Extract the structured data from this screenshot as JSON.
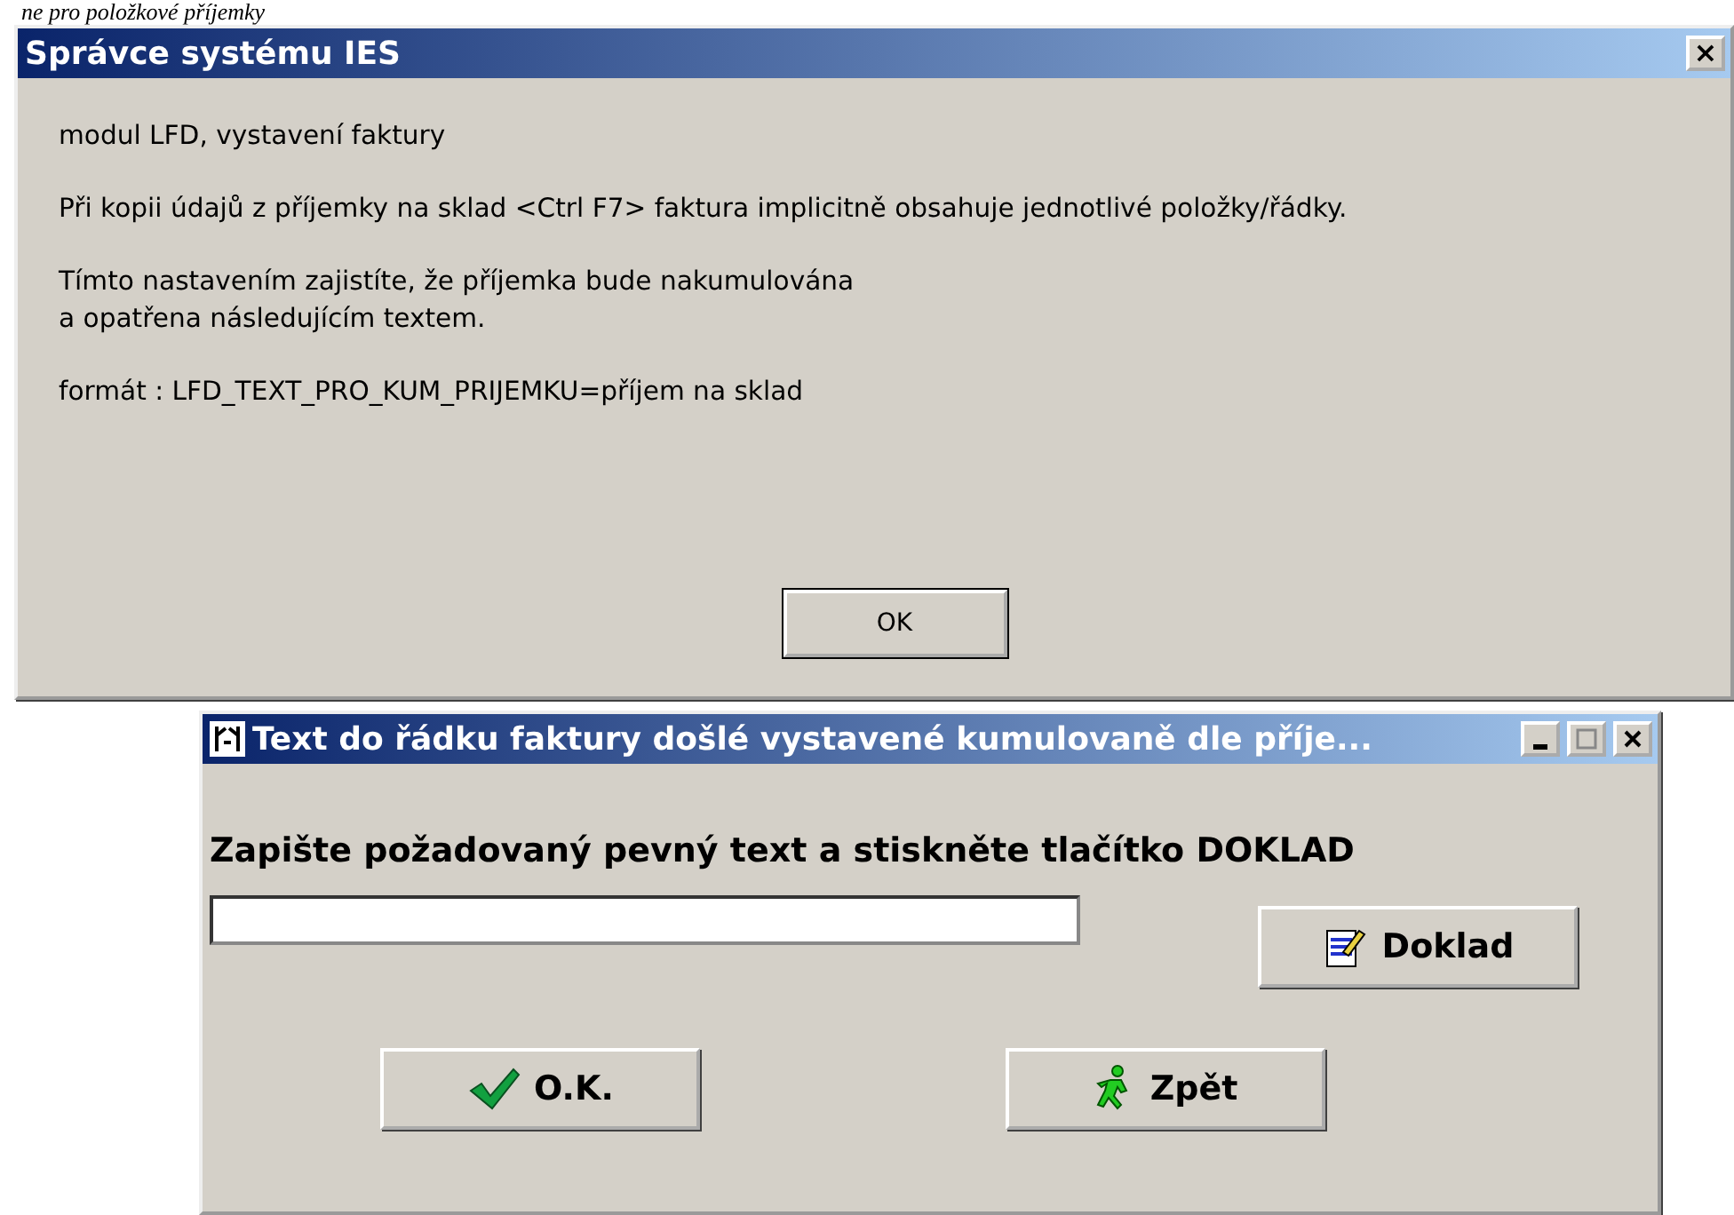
{
  "caption": "ne pro položkové příjemky",
  "message_dialog": {
    "title": "Správce systému IES",
    "close": "×",
    "paragraphs": [
      [
        "modul LFD, vystavení faktury"
      ],
      [
        "Při kopii údajů z příjemky na sklad <Ctrl F7> faktura implicitně obsahuje jednotlivé položky/řádky."
      ],
      [
        "Tímto nastavením zajistíte, že příjemka bude nakumulována",
        "a opatřena následujícím textem."
      ],
      [
        "formát : LFD_TEXT_PRO_KUM_PRIJEMKU=příjem na sklad"
      ]
    ],
    "button": "OK"
  },
  "text_dialog": {
    "title": "Text do řádku faktury došlé vystavené kumulovaně dle příje...",
    "prompt": "Zapište požadovaný pevný text a stiskněte tlačítko DOKLAD",
    "doc_button": "Doklad",
    "buttons": [
      {
        "kind": "ok",
        "label": "O.K."
      },
      {
        "kind": "back",
        "label": "Zpět"
      }
    ]
  }
}
